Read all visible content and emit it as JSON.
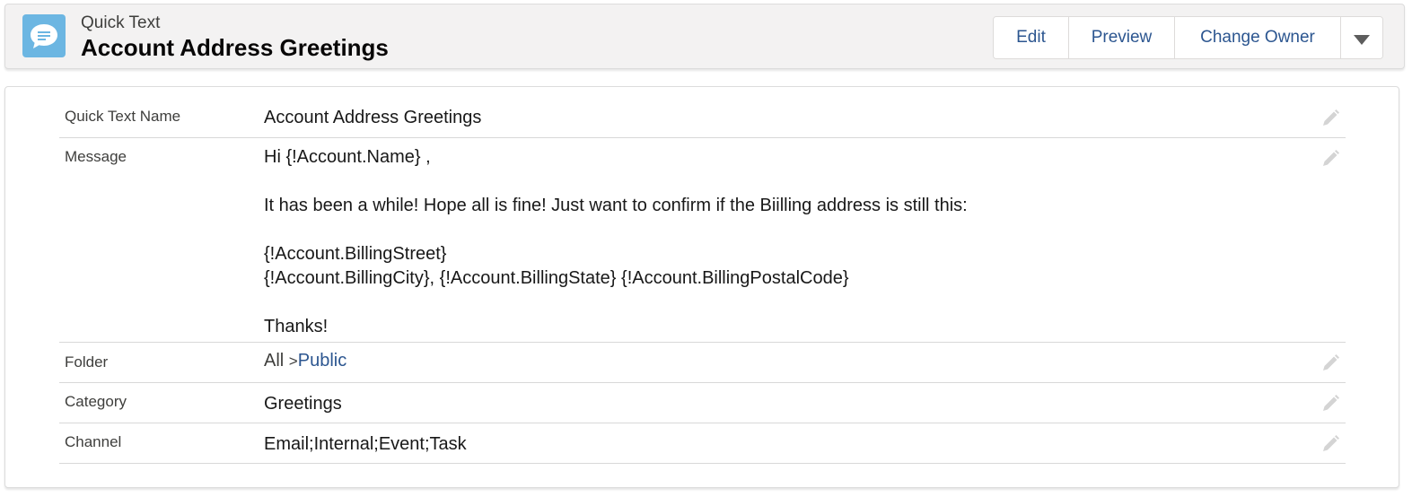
{
  "header": {
    "subtitle": "Quick Text",
    "title": "Account Address Greetings",
    "icon": "chat-bubble-icon",
    "icon_color": "#6cb6e2",
    "actions": {
      "edit": "Edit",
      "preview": "Preview",
      "change_owner": "Change Owner"
    }
  },
  "fields": {
    "name": {
      "label": "Quick Text Name",
      "value": "Account Address Greetings"
    },
    "message": {
      "label": "Message",
      "lines": [
        "Hi {!Account.Name} ,",
        "",
        "It has been a while! Hope all is fine! Just want to confirm if the Biilling address is still this:",
        "",
        "{!Account.BillingStreet}",
        "{!Account.BillingCity}, {!Account.BillingState} {!Account.BillingPostalCode}",
        "",
        "Thanks!"
      ]
    },
    "folder": {
      "label": "Folder",
      "prefix": "All",
      "separator": ">",
      "link": "Public"
    },
    "category": {
      "label": "Category",
      "value": "Greetings"
    },
    "channel": {
      "label": "Channel",
      "value": "Email;Internal;Event;Task"
    }
  },
  "colors": {
    "link": "#2c5690",
    "pencil": "#d4d4d4"
  }
}
